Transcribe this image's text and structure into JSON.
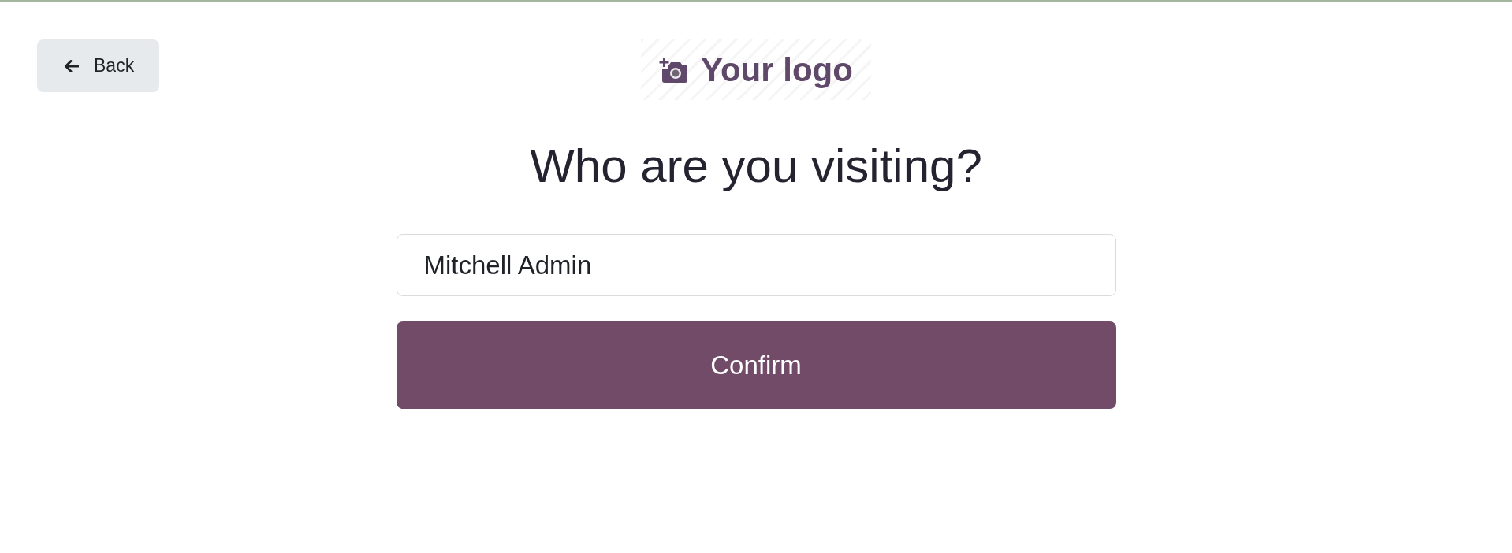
{
  "back_button": {
    "label": "Back"
  },
  "logo": {
    "text": "Your logo"
  },
  "title": "Who are you visiting?",
  "visitor_field": {
    "value": "Mitchell Admin"
  },
  "confirm_button": {
    "label": "Confirm"
  }
}
